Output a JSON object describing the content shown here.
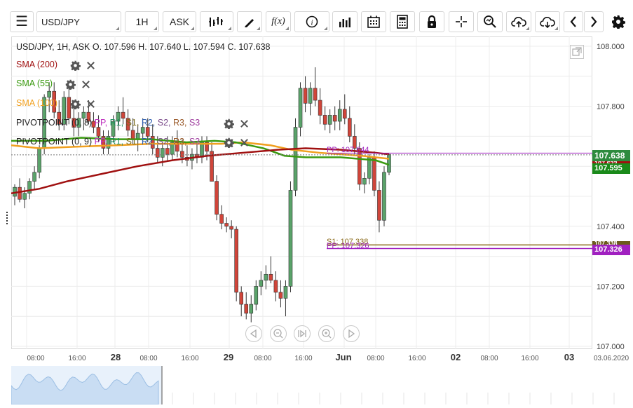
{
  "toolbar": {
    "symbol": "USD/JPY",
    "interval": "1H",
    "price_type": "ASK",
    "icons": [
      "menu-icon",
      "bar-style-icon",
      "draw-pen-icon",
      "function-fx-icon",
      "info-icon",
      "volume-bars-icon",
      "calendar-icon",
      "calculator-icon",
      "lock-icon",
      "crosshair-icon",
      "zoom-icon",
      "upload-cloud-icon",
      "download-cloud-icon",
      "chevron-left-icon",
      "chevron-right-icon",
      "gear-icon"
    ],
    "fx_label": "f(x)"
  },
  "legend": {
    "ohlc": "USD/JPY, 1H, ASK   O. 107.596 H. 107.640 L. 107.594 C. 107.638",
    "sma200": "SMA (200)",
    "sma55": "SMA (55)",
    "sma100": "SMA (100)",
    "pivot1_name": "PIVOTPOINT (0, 8)",
    "pivot2_name": "PIVOTPOINT (0, 9)",
    "pivot1_levels": [
      {
        "text": "PP,",
        "color": "#c030c0"
      },
      {
        "text": "R1,",
        "color": "#1f8f5f"
      },
      {
        "text": "S1,",
        "color": "#7a6a1a"
      },
      {
        "text": "R2,",
        "color": "#2f5faf"
      },
      {
        "text": "S2,",
        "color": "#7a4a8a"
      },
      {
        "text": "R3,",
        "color": "#9a5a2a"
      },
      {
        "text": "S3",
        "color": "#a040a0"
      }
    ],
    "pivot2_levels": [
      {
        "text": "PP,",
        "color": "#c030c0"
      },
      {
        "text": "R1,",
        "color": "#1f8f5f"
      },
      {
        "text": "S1,",
        "color": "#7a6a1a"
      },
      {
        "text": "R2,",
        "color": "#2f5faf"
      },
      {
        "text": "S2,",
        "color": "#7a4a8a"
      },
      {
        "text": "R3,",
        "color": "#9a5a2a"
      },
      {
        "text": "S3",
        "color": "#a040a0"
      }
    ]
  },
  "colors": {
    "up": "#5aa36a",
    "down": "#d0453a",
    "sma200": "#a01010",
    "sma55": "#3a9a10",
    "sma100": "#f0a020",
    "pp": "#a020c0",
    "s1": "#8a6a1a",
    "last_price": "#2e8b3e",
    "sma55_tag": "#1a8a1a"
  },
  "price_axis": {
    "ticks": [
      "108.000",
      "107.800",
      "107.600",
      "107.400",
      "107.200",
      "107.000"
    ]
  },
  "tags": {
    "last": "107.638",
    "sma_a": "107.622",
    "sma_b": "107.595",
    "s1": "107.338",
    "pp": "107.326"
  },
  "annotations": {
    "pp_top": "PP: 107.644",
    "s1": "S1: 107.338",
    "pp_bottom": "PP: 107.326"
  },
  "time_axis": {
    "labels": [
      {
        "t": "08:00",
        "bold": false
      },
      {
        "t": "16:00",
        "bold": false
      },
      {
        "t": "28",
        "bold": true
      },
      {
        "t": "08:00",
        "bold": false
      },
      {
        "t": "16:00",
        "bold": false
      },
      {
        "t": "29",
        "bold": true
      },
      {
        "t": "08:00",
        "bold": false
      },
      {
        "t": "16:00",
        "bold": false
      },
      {
        "t": "Jun",
        "bold": true
      },
      {
        "t": "08:00",
        "bold": false
      },
      {
        "t": "16:00",
        "bold": false
      },
      {
        "t": "02",
        "bold": true
      },
      {
        "t": "08:00",
        "bold": false
      },
      {
        "t": "16:00",
        "bold": false
      },
      {
        "t": "03",
        "bold": true
      },
      {
        "t": "03.06.2020",
        "bold": false
      }
    ]
  },
  "chart_data": {
    "type": "candlestick",
    "ylim": [
      107.0,
      108.0
    ],
    "candles": [
      [
        107.5,
        107.54,
        107.47,
        107.53
      ],
      [
        107.53,
        107.56,
        107.48,
        107.49
      ],
      [
        107.49,
        107.53,
        107.46,
        107.51
      ],
      [
        107.51,
        107.56,
        107.49,
        107.55
      ],
      [
        107.55,
        107.6,
        107.52,
        107.58
      ],
      [
        107.58,
        107.67,
        107.56,
        107.66
      ],
      [
        107.66,
        107.84,
        107.64,
        107.83
      ],
      [
        107.83,
        107.88,
        107.78,
        107.85
      ],
      [
        107.85,
        107.88,
        107.76,
        107.78
      ],
      [
        107.78,
        107.82,
        107.72,
        107.74
      ],
      [
        107.74,
        107.85,
        107.72,
        107.83
      ],
      [
        107.83,
        107.86,
        107.74,
        107.76
      ],
      [
        107.76,
        107.8,
        107.7,
        107.73
      ],
      [
        107.73,
        107.78,
        107.7,
        107.76
      ],
      [
        107.76,
        107.8,
        107.72,
        107.78
      ],
      [
        107.78,
        107.82,
        107.74,
        107.75
      ],
      [
        107.75,
        107.78,
        107.71,
        107.73
      ],
      [
        107.73,
        107.77,
        107.68,
        107.7
      ],
      [
        107.7,
        107.72,
        107.64,
        107.66
      ],
      [
        107.66,
        107.72,
        107.64,
        107.7
      ],
      [
        107.7,
        107.77,
        107.68,
        107.75
      ],
      [
        107.75,
        107.8,
        107.72,
        107.78
      ],
      [
        107.78,
        107.83,
        107.74,
        107.76
      ],
      [
        107.76,
        107.79,
        107.7,
        107.72
      ],
      [
        107.72,
        107.76,
        107.67,
        107.69
      ],
      [
        107.69,
        107.74,
        107.65,
        107.71
      ],
      [
        107.71,
        107.76,
        107.68,
        107.73
      ],
      [
        107.73,
        107.76,
        107.68,
        107.7
      ],
      [
        107.7,
        107.74,
        107.64,
        107.66
      ],
      [
        107.66,
        107.7,
        107.61,
        107.63
      ],
      [
        107.63,
        107.68,
        107.6,
        107.66
      ],
      [
        107.66,
        107.7,
        107.62,
        107.64
      ],
      [
        107.64,
        107.7,
        107.62,
        107.68
      ],
      [
        107.68,
        107.72,
        107.63,
        107.65
      ],
      [
        107.65,
        107.69,
        107.61,
        107.63
      ],
      [
        107.63,
        107.67,
        107.6,
        107.62
      ],
      [
        107.62,
        107.66,
        107.59,
        107.64
      ],
      [
        107.64,
        107.68,
        107.61,
        107.63
      ],
      [
        107.63,
        107.7,
        107.61,
        107.68
      ],
      [
        107.68,
        107.7,
        107.62,
        107.65
      ],
      [
        107.65,
        107.68,
        107.55,
        107.55
      ],
      [
        107.55,
        107.57,
        107.42,
        107.44
      ],
      [
        107.44,
        107.47,
        107.39,
        107.41
      ],
      [
        107.41,
        107.43,
        107.38,
        107.4
      ],
      [
        107.4,
        107.42,
        107.36,
        107.39
      ],
      [
        107.39,
        107.4,
        107.15,
        107.18
      ],
      [
        107.18,
        107.2,
        107.1,
        107.14
      ],
      [
        107.14,
        107.18,
        107.09,
        107.11
      ],
      [
        107.11,
        107.17,
        107.08,
        107.14
      ],
      [
        107.14,
        107.22,
        107.12,
        107.2
      ],
      [
        107.2,
        107.25,
        107.17,
        107.22
      ],
      [
        107.22,
        107.27,
        107.19,
        107.24
      ],
      [
        107.24,
        107.3,
        107.21,
        107.22
      ],
      [
        107.22,
        107.25,
        107.15,
        107.18
      ],
      [
        107.18,
        107.22,
        107.13,
        107.16
      ],
      [
        107.16,
        107.22,
        107.1,
        107.2
      ],
      [
        107.2,
        107.55,
        107.18,
        107.52
      ],
      [
        107.52,
        107.76,
        107.5,
        107.73
      ],
      [
        107.73,
        107.88,
        107.7,
        107.86
      ],
      [
        107.86,
        107.9,
        107.78,
        107.81
      ],
      [
        107.81,
        107.88,
        107.77,
        107.86
      ],
      [
        107.86,
        107.93,
        107.8,
        107.82
      ],
      [
        107.82,
        107.86,
        107.74,
        107.77
      ],
      [
        107.77,
        107.8,
        107.72,
        107.74
      ],
      [
        107.74,
        107.79,
        107.71,
        107.77
      ],
      [
        107.77,
        107.8,
        107.72,
        107.75
      ],
      [
        107.75,
        107.82,
        107.72,
        107.79
      ],
      [
        107.79,
        107.84,
        107.74,
        107.76
      ],
      [
        107.76,
        107.8,
        107.68,
        107.7
      ],
      [
        107.7,
        107.74,
        107.64,
        107.66
      ],
      [
        107.66,
        107.68,
        107.52,
        107.54
      ],
      [
        107.54,
        107.58,
        107.51,
        107.56
      ],
      [
        107.56,
        107.64,
        107.54,
        107.63
      ],
      [
        107.63,
        107.65,
        107.5,
        107.52
      ],
      [
        107.52,
        107.55,
        107.38,
        107.42
      ],
      [
        107.42,
        107.6,
        107.4,
        107.58
      ],
      [
        107.58,
        107.64,
        107.57,
        107.64
      ]
    ]
  }
}
